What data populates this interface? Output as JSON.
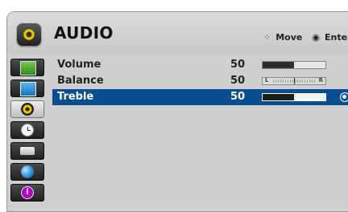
{
  "menu": {
    "title": "AUDIO",
    "title_icon": "audio-speaker-icon"
  },
  "nav_hints": {
    "move_icon": "⁘",
    "move_label": "Move",
    "enter_icon": "◉",
    "enter_label": "Enter"
  },
  "sidebar": {
    "items": [
      {
        "name": "picture",
        "icon": "picture-icon",
        "active": false
      },
      {
        "name": "screen",
        "icon": "screen-icon",
        "active": false
      },
      {
        "name": "audio",
        "icon": "audio-icon",
        "active": true
      },
      {
        "name": "time",
        "icon": "clock-icon",
        "active": false
      },
      {
        "name": "option",
        "icon": "option-icon",
        "active": false
      },
      {
        "name": "network",
        "icon": "globe-icon",
        "active": false
      },
      {
        "name": "info",
        "icon": "info-icon",
        "active": false,
        "glyph": "i"
      }
    ]
  },
  "settings": [
    {
      "label": "Volume",
      "value": "50",
      "control": "bar",
      "level": 0.5
    },
    {
      "label": "Balance",
      "value": "50",
      "control": "balance",
      "left_label": "L",
      "right_label": "R",
      "level": 0.5
    },
    {
      "label": "Treble",
      "value": "50",
      "control": "bar",
      "level": 0.5,
      "selected": true
    }
  ],
  "colors": {
    "selected_row": "#0a4d93",
    "panel": "#cfcfcf"
  }
}
